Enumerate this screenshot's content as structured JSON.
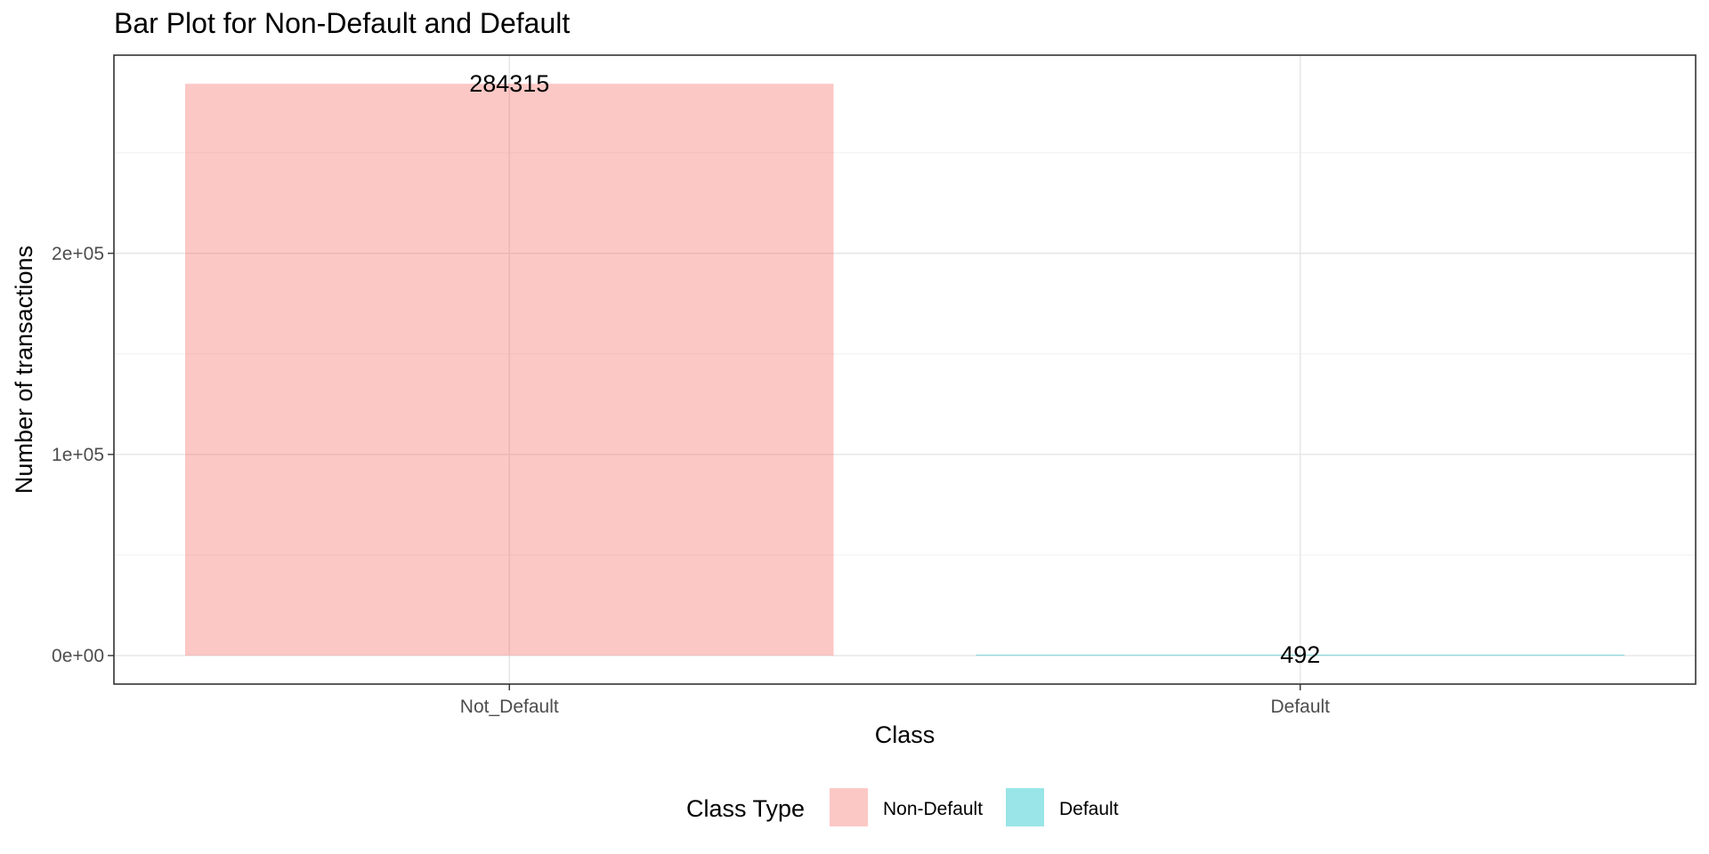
{
  "chart_data": {
    "type": "bar",
    "title": "Bar Plot for Non-Default and Default",
    "xlabel": "Class",
    "ylabel": "Number of transactions",
    "categories": [
      "Not_Default",
      "Default"
    ],
    "values": [
      284315,
      492
    ],
    "data_labels": [
      "284315",
      "492"
    ],
    "colors": [
      "#F8766D",
      "#00BFC4"
    ],
    "bar_opacity": 0.4,
    "ylim": [
      -14190,
      298530
    ],
    "yticks": [
      0,
      100000,
      200000
    ],
    "ytick_labels": [
      "0e+00",
      "1e+05",
      "2e+05"
    ],
    "y_minor_ticks": [
      50000,
      150000,
      250000
    ],
    "grid": true,
    "legend": {
      "title": "Class Type",
      "position": "bottom",
      "entries": [
        "Non-Default",
        "Default"
      ]
    }
  }
}
